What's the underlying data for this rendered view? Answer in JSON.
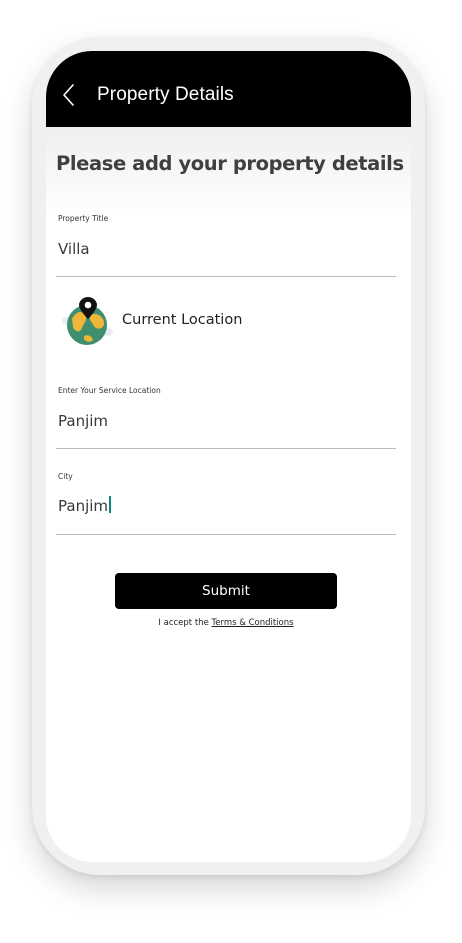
{
  "header": {
    "title": "Property Details"
  },
  "page": {
    "heading": "Please add your property details"
  },
  "form": {
    "property_title": {
      "label": "Property Title",
      "value": "Villa"
    },
    "current_location": {
      "label": "Current Location"
    },
    "service_location": {
      "label": "Enter Your Service Location",
      "value": "Panjim"
    },
    "city": {
      "label": "City",
      "value": "Panjim"
    }
  },
  "submit": {
    "label": "Submit"
  },
  "terms": {
    "prefix": "I accept the ",
    "link": "Terms & Conditions"
  },
  "colors": {
    "app_bar": "#000000",
    "caret": "#0a8a78",
    "globe_land": "#f0b63a",
    "globe_ocean": "#3f8f6e"
  }
}
